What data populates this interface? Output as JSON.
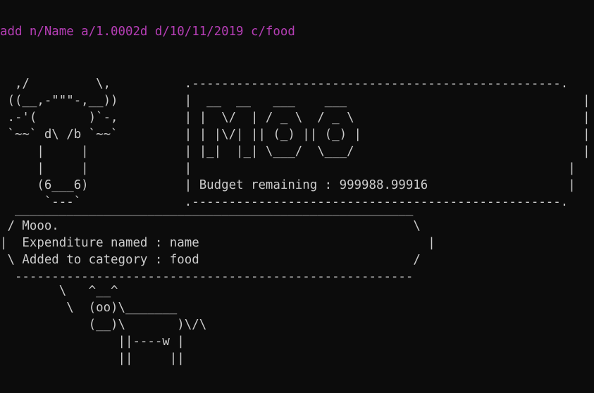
{
  "terminal": {
    "command": "add n/Name a/1.0002d d/10/11/2019 c/food",
    "colors": {
      "background": "#0c0c0c",
      "text": "#cccccc",
      "command": "#b63eb6"
    },
    "banner_lines": [
      "  ,/         \\,          .--------------------------------------------------.",
      " ((__,-\"\"\"-,__))         |  __  __   ___    ___                                |",
      " .-'(       )`-,         | |  \\/  | / _ \\  / _ \\                               |",
      " `~~` d\\ /b `~~`         | | |\\/| || (_) || (_) |                              |",
      "     |     |             | |_|  |_| \\___/  \\___/                               |",
      "     |     |             |                                                   |",
      "     (6___6)             | Budget remaining : 999988.99916                   |",
      "      `---`              .--------------------------------------------------."
    ],
    "speech_lines": [
      "  ______________________________________________________",
      " / Mooo.                                                \\",
      "|  Expenditure named : name                               |",
      " \\ Added to category : food                             /",
      "  ------------------------------------------------------"
    ],
    "cow_lines": [
      "        \\   ^__^",
      "         \\  (oo)\\_______",
      "            (__)\\       )\\/\\",
      "                ||----w |",
      "                ||     ||"
    ]
  }
}
